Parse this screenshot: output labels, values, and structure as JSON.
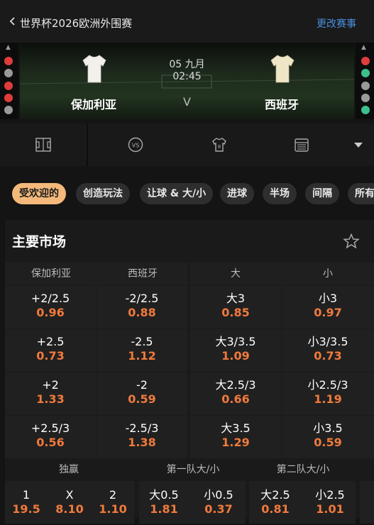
{
  "header": {
    "title": "世界杯2026欧洲外围赛",
    "change_label": "更改赛事"
  },
  "match": {
    "home": "保加利亚",
    "away": "西班牙",
    "date": "05 九月",
    "time": "02:45",
    "vs": "V",
    "left_form": [
      "#e03c3c",
      "#9a9a9a",
      "#e03c3c",
      "#e03c3c",
      "#9a9a9a"
    ],
    "right_form": [
      "#e03c3c",
      "#3cc08c",
      "#9a9a9a",
      "#9a9a9a",
      "#3cc08c"
    ],
    "home_shirt_color": "#f2f0ea",
    "away_shirt_color": "#efe6c8"
  },
  "icons": [
    "pitch-icon",
    "versus-icon",
    "jersey-icon",
    "calendar-icon",
    "dropdown-arrow-icon"
  ],
  "vs_icon_text": "VS",
  "jersey_number": "8",
  "tabs": [
    {
      "label": "受欢迎的"
    },
    {
      "label": "创造玩法"
    },
    {
      "label": "让球 & 大/小"
    },
    {
      "label": "进球"
    },
    {
      "label": "半场"
    },
    {
      "label": "间隔"
    },
    {
      "label": "所有"
    }
  ],
  "market": {
    "title": "主要市场",
    "columns": [
      "保加利亚",
      "西班牙",
      "大",
      "小"
    ],
    "rows": [
      [
        {
          "l": "+2/2.5",
          "v": "0.96"
        },
        {
          "l": "-2/2.5",
          "v": "0.88"
        },
        {
          "l": "大3",
          "v": "0.85"
        },
        {
          "l": "小3",
          "v": "0.97"
        }
      ],
      [
        {
          "l": "+2.5",
          "v": "0.73"
        },
        {
          "l": "-2.5",
          "v": "1.12"
        },
        {
          "l": "大3/3.5",
          "v": "1.09"
        },
        {
          "l": "小3/3.5",
          "v": "0.73"
        }
      ],
      [
        {
          "l": "+2",
          "v": "1.33"
        },
        {
          "l": "-2",
          "v": "0.59"
        },
        {
          "l": "大2.5/3",
          "v": "0.66"
        },
        {
          "l": "小2.5/3",
          "v": "1.19"
        }
      ],
      [
        {
          "l": "+2.5/3",
          "v": "0.56"
        },
        {
          "l": "-2.5/3",
          "v": "1.38"
        },
        {
          "l": "大3.5",
          "v": "1.29"
        },
        {
          "l": "小3.5",
          "v": "0.59"
        }
      ]
    ],
    "bottom_headers": [
      "独赢",
      "第一队大/小",
      "第二队大/小"
    ],
    "bottom": [
      {
        "l": "1",
        "v": "19.5"
      },
      {
        "l": "X",
        "v": "8.10"
      },
      {
        "l": "2",
        "v": "1.10"
      },
      {
        "l": "大0.5",
        "v": "1.81"
      },
      {
        "l": "小0.5",
        "v": "0.37"
      },
      {
        "l": "大2.5",
        "v": "0.81"
      },
      {
        "l": "小2.5",
        "v": "1.01"
      }
    ]
  }
}
